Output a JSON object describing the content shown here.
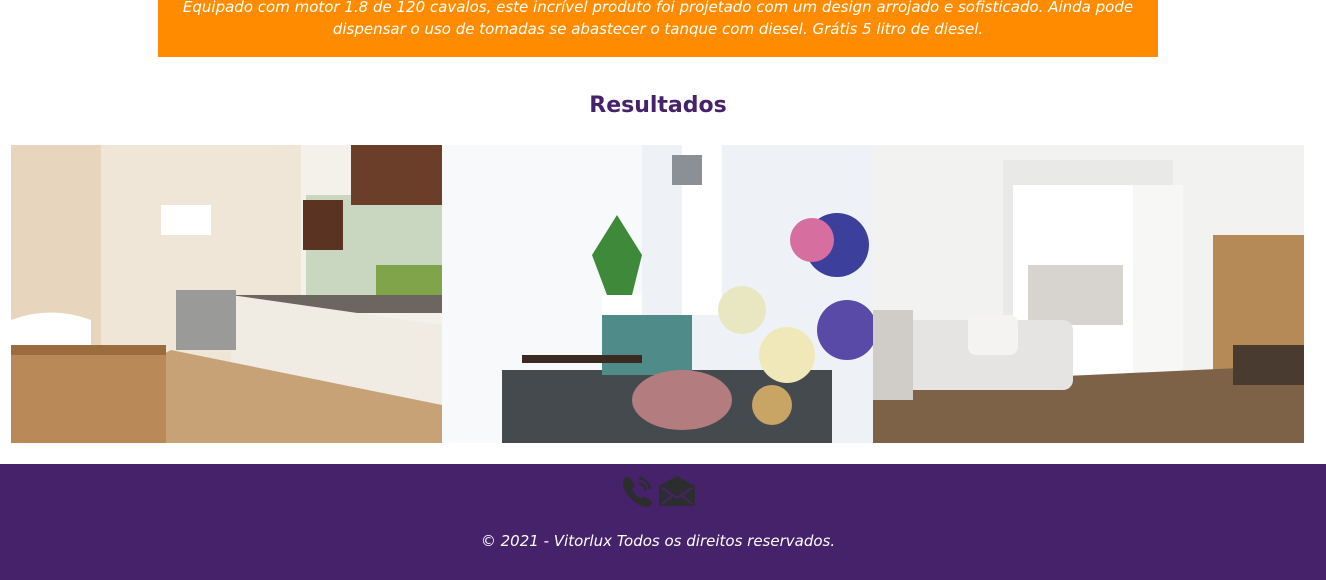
{
  "promo": {
    "line1": "Equipado com motor 1.8 de 120 cavalos, este incrível produto foi projetado com um design arrojado e sofisticado. Ainda pode",
    "line2": "dispensar o uso de tomadas se abastecer o tanque com diesel. Grátis 5 litro de diesel."
  },
  "results": {
    "title": "Resultados"
  },
  "gallery": {
    "images": [
      {
        "name": "kitchen-photo"
      },
      {
        "name": "living-room-flowers-photo"
      },
      {
        "name": "bedroom-sofa-photo"
      }
    ]
  },
  "footer": {
    "icons": [
      "phone-icon",
      "mail-icon"
    ],
    "copyright": "© 2021 - Vitorlux Todos os direitos reservados."
  },
  "colors": {
    "banner": "#ff8c00",
    "title": "#45226a",
    "footer": "#45226a"
  }
}
